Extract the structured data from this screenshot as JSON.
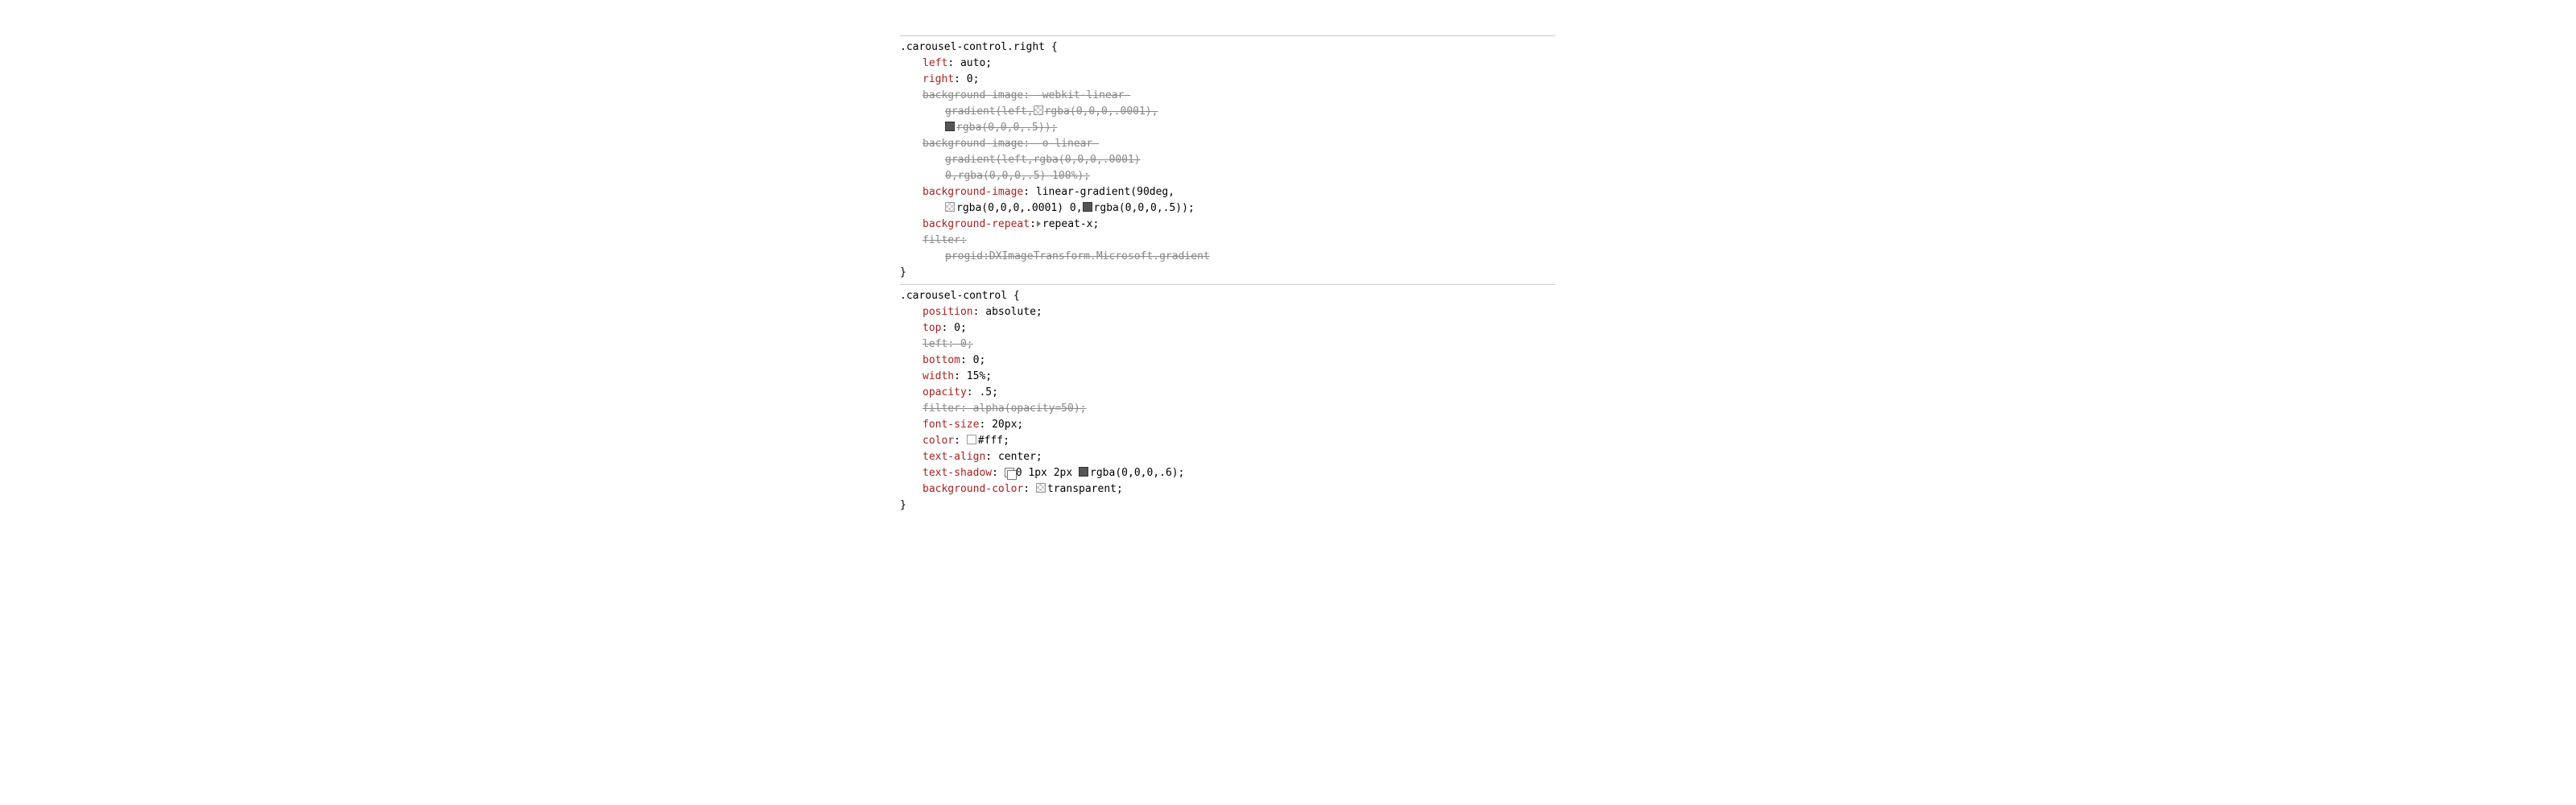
{
  "rules": [
    {
      "selector": ".carousel-control.right",
      "decls": [
        {
          "kind": "plain",
          "prop": "left",
          "val": "auto"
        },
        {
          "kind": "plain",
          "prop": "right",
          "val": "0"
        },
        {
          "kind": "struck-head",
          "text": "background-image: -webkit-linear-"
        },
        {
          "kind": "struck-sub",
          "swatch": "trans",
          "before": "gradient(left,",
          "after": "rgba(0,0,0,.0001),"
        },
        {
          "kind": "struck-sub",
          "swatch": "dark",
          "before": "",
          "after": "rgba(0,0,0,.5));"
        },
        {
          "kind": "struck-head",
          "text": "background-image: -o-linear-"
        },
        {
          "kind": "struck-sub",
          "swatch": null,
          "before": "",
          "after": "gradient(left,rgba(0,0,0,.0001)"
        },
        {
          "kind": "struck-sub",
          "swatch": null,
          "before": "",
          "after": "0,rgba(0,0,0,.5) 100%);"
        },
        {
          "kind": "plain-head",
          "prop": "background-image",
          "tail": "linear-gradient(90deg,"
        },
        {
          "kind": "plain-sub",
          "content": "gradient-line",
          "swA": "trans",
          "textA": "rgba(0,0,0,.0001) 0,",
          "swB": "dark",
          "textB": "rgba(0,0,0,.5));"
        },
        {
          "kind": "plain-expand",
          "prop": "background-repeat",
          "val": "repeat-x"
        },
        {
          "kind": "struck-head",
          "text": "filter:"
        },
        {
          "kind": "struck-sub",
          "swatch": null,
          "before": "",
          "after": "progid:DXImageTransform.Microsoft.gradient"
        }
      ]
    },
    {
      "selector": ".carousel-control",
      "decls": [
        {
          "kind": "plain",
          "prop": "position",
          "val": "absolute"
        },
        {
          "kind": "plain",
          "prop": "top",
          "val": "0"
        },
        {
          "kind": "struck",
          "prop": "left",
          "val": "0"
        },
        {
          "kind": "plain",
          "prop": "bottom",
          "val": "0"
        },
        {
          "kind": "plain",
          "prop": "width",
          "val": "15%"
        },
        {
          "kind": "plain",
          "prop": "opacity",
          "val": ".5"
        },
        {
          "kind": "struck-full",
          "text": "filter: alpha(opacity=50);"
        },
        {
          "kind": "plain",
          "prop": "font-size",
          "val": "20px"
        },
        {
          "kind": "color",
          "prop": "color",
          "swatch": "white",
          "val": "#fff"
        },
        {
          "kind": "plain",
          "prop": "text-align",
          "val": "center"
        },
        {
          "kind": "shadow",
          "prop": "text-shadow",
          "prefix": "0 1px 2px ",
          "swatch": "dark",
          "val": "rgba(0,0,0,.6)"
        },
        {
          "kind": "color",
          "prop": "background-color",
          "swatch": "trans",
          "val": "transparent"
        }
      ]
    }
  ]
}
